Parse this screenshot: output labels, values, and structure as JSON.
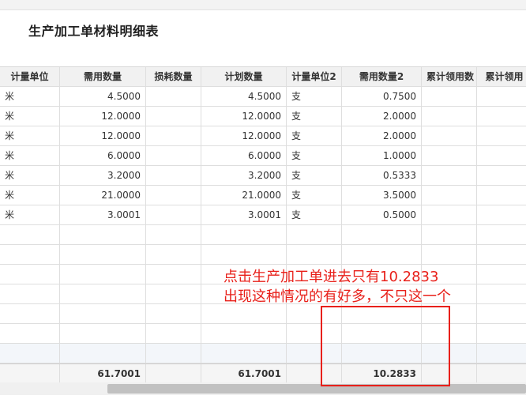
{
  "page": {
    "title": "生产加工单材料明细表"
  },
  "table": {
    "columns": [
      "计量单位",
      "需用数量",
      "损耗数量",
      "计划数量",
      "计量单位2",
      "需用数量2",
      "累计领用数",
      "累计领用"
    ],
    "rows": [
      [
        "米",
        "4.5000",
        "",
        "4.5000",
        "支",
        "0.7500",
        "",
        ""
      ],
      [
        "米",
        "12.0000",
        "",
        "12.0000",
        "支",
        "2.0000",
        "",
        ""
      ],
      [
        "米",
        "12.0000",
        "",
        "12.0000",
        "支",
        "2.0000",
        "",
        ""
      ],
      [
        "米",
        "6.0000",
        "",
        "6.0000",
        "支",
        "1.0000",
        "",
        ""
      ],
      [
        "米",
        "3.2000",
        "",
        "3.2000",
        "支",
        "0.5333",
        "",
        ""
      ],
      [
        "米",
        "21.0000",
        "",
        "21.0000",
        "支",
        "3.5000",
        "",
        ""
      ],
      [
        "米",
        "3.0001",
        "",
        "3.0001",
        "支",
        "0.5000",
        "",
        ""
      ]
    ],
    "empty_rows": 7,
    "totals": [
      "",
      "61.7001",
      "",
      "61.7001",
      "",
      "10.2833",
      "",
      ""
    ]
  },
  "annotation": {
    "line1": "点击生产加工单进去只有10.2833",
    "line2": "出现这种情况的有好多，不只这一个",
    "color": "#e8201a"
  }
}
